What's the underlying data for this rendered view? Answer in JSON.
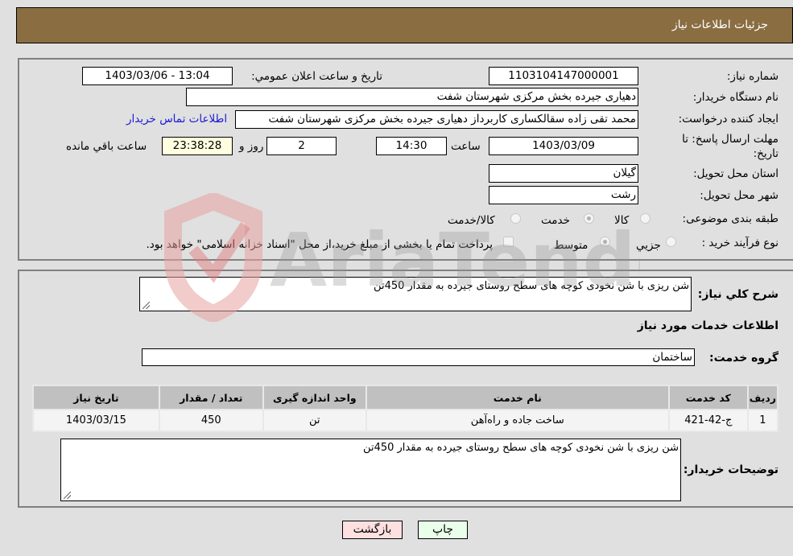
{
  "header": {
    "title": "جزئیات اطلاعات نیاز"
  },
  "form": {
    "need_number": {
      "label": "شماره نیاز:",
      "value": "1103104147000001"
    },
    "announce_datetime": {
      "label": "تاریخ و ساعت اعلان عمومي:",
      "value": "1403/03/06 - 13:04"
    },
    "buyer_org": {
      "label": "نام دستگاه خريدار:",
      "value": "دهیاری جیرده بخش مرکزی شهرستان شفت"
    },
    "requester": {
      "label": "ایجاد کننده درخواست:",
      "value": "محمد تقی زاده سقالکساری کاربرداز دهیاری جیرده بخش مرکزی شهرستان شفت",
      "contact_link": "اطلاعات تماس خریدار"
    },
    "deadline": {
      "label_line1": "مهلت ارسال پاسخ: تا",
      "label_line2": "تاریخ:",
      "date": "1403/03/09",
      "time_label": "ساعت",
      "time": "14:30",
      "days": "2",
      "days_label": "روز و",
      "remaining": "23:38:28",
      "remaining_label": "ساعت باقي مانده"
    },
    "province": {
      "label": "استان محل تحویل:",
      "value": "گیلان"
    },
    "city": {
      "label": "شهر محل تحویل:",
      "value": "رشت"
    },
    "category": {
      "label": "طبقه بندی موضوعی:",
      "options": [
        "کالا",
        "خدمت",
        "کالا/خدمت"
      ],
      "selected": "خدمت"
    },
    "purchase_type": {
      "label": "نوع فرآیند خرید :",
      "options": [
        "جزيي",
        "متوسط"
      ],
      "selected": "متوسط",
      "treasury_note": "پرداخت تمام یا بخشی از مبلغ خرید،از محل \"اسناد خزانه اسلامی\" خواهد بود."
    }
  },
  "details": {
    "description_label": "شرح كلي نياز:",
    "description": "شن ریزی با شن نخودی کوچه های سطح روستای جیرده به مقدار 450تن",
    "services_heading": "اطلاعات خدمات مورد نياز",
    "service_group_label": "گروه خدمت:",
    "service_group": "ساختمان",
    "table": {
      "headers": [
        "رديف",
        "كد خدمت",
        "نام خدمت",
        "واحد اندازه گيری",
        "تعداد / مقدار",
        "تاريخ نياز"
      ],
      "rows": [
        [
          "1",
          "ج-42-421",
          "ساخت جاده و راه‌آهن",
          "تن",
          "450",
          "1403/03/15"
        ]
      ]
    },
    "buyer_notes_label": "توضيحات خريدار:",
    "buyer_notes": "شن ریزی با شن نخودی کوچه های سطح روستای جیرده به مقدار 450تن"
  },
  "buttons": {
    "print": "چاپ",
    "back": "بازگشت"
  },
  "colors": {
    "header_bg": "#8b6d42",
    "print_bg": "#eaffea",
    "back_bg": "#ffe0e0",
    "remaining_bg": "#ffffe0",
    "link": "#1a1ad6"
  },
  "watermark": "AriaTender.neT"
}
